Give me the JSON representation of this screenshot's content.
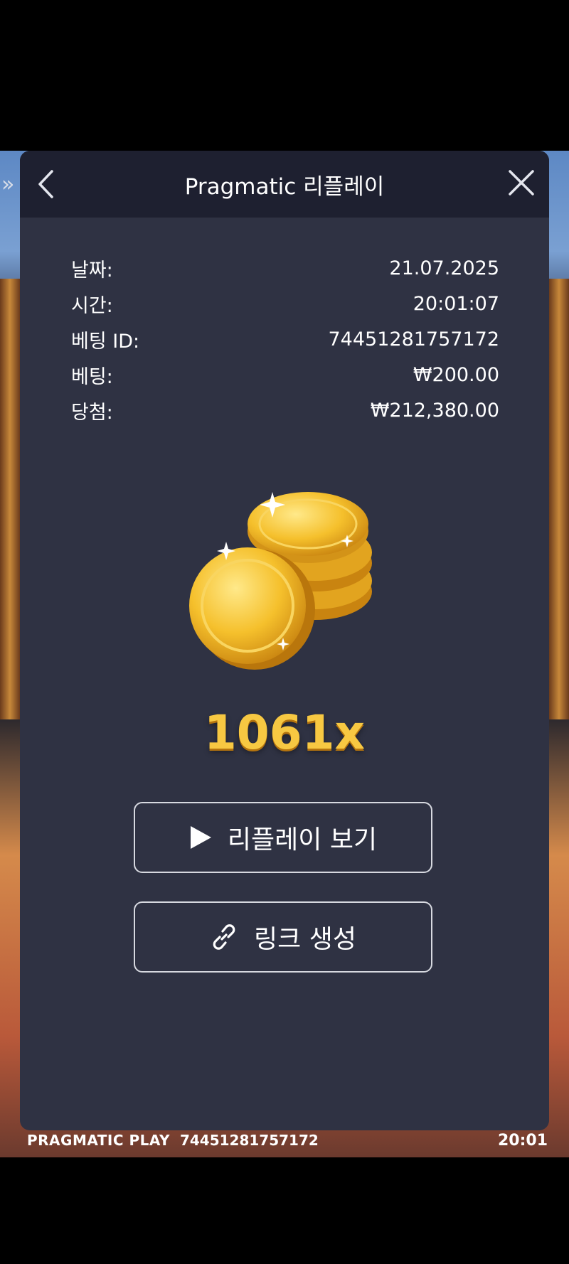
{
  "modal": {
    "title": "Pragmatic 리플레이",
    "back_icon": "chevron-left-icon",
    "close_icon": "close-icon"
  },
  "details": [
    {
      "label": "날짜:",
      "value": "21.07.2025"
    },
    {
      "label": "시간:",
      "value": "20:01:07"
    },
    {
      "label": "베팅 ID:",
      "value": "74451281757172"
    },
    {
      "label": "베팅:",
      "value": "₩200.00"
    },
    {
      "label": "당첨:",
      "value": "₩212,380.00"
    }
  ],
  "multiplier": "1061x",
  "buttons": {
    "replay_label": "리플레이 보기",
    "replay_icon": "play-icon",
    "link_label": "링크 생성",
    "link_icon": "link-icon"
  },
  "footer": {
    "brand": "PRAGMATIC PLAY",
    "bet_id": "74451281757172",
    "time": "20:01"
  },
  "colors": {
    "modal_bg": "#2f3243",
    "header_bg": "#1e2030",
    "accent_gold": "#f7c842"
  }
}
